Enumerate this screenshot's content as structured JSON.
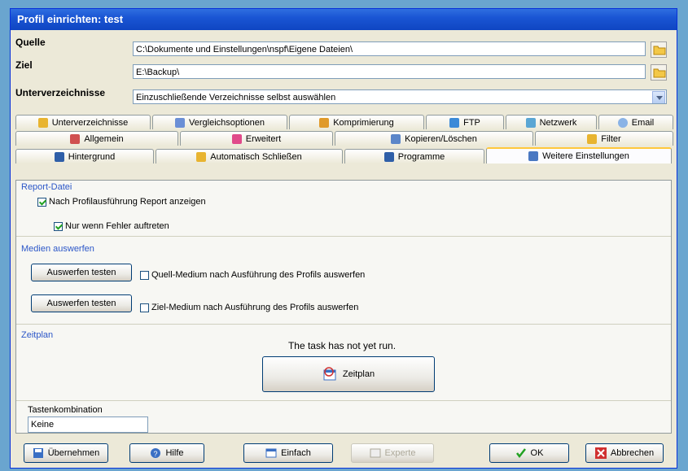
{
  "window": {
    "title": "Profil einrichten: test"
  },
  "fields": {
    "source": {
      "label": "Quelle",
      "value": "C:\\Dokumente und Einstellungen\\nspf\\Eigene Dateien\\"
    },
    "target": {
      "label": "Ziel",
      "value": "E:\\Backup\\"
    },
    "subdirs": {
      "label": "Unterverzeichnisse",
      "value": "Einzuschließende Verzeichnisse selbst auswählen"
    }
  },
  "tabs": {
    "row1": [
      "Unterverzeichnisse",
      "Vergleichsoptionen",
      "Komprimierung",
      "FTP",
      "Netzwerk",
      "Email"
    ],
    "row2": [
      "Allgemein",
      "Erweitert",
      "Kopieren/Löschen",
      "Filter"
    ],
    "row3": [
      "Hintergrund",
      "Automatisch Schließen",
      "Programme",
      "Weitere Einstellungen"
    ]
  },
  "report": {
    "group": "Report-Datei",
    "show_report": {
      "label": "Nach Profilausführung Report anzeigen",
      "checked": true
    },
    "only_errors": {
      "label": "Nur wenn Fehler auftreten",
      "checked": true
    }
  },
  "eject": {
    "group": "Medien auswerfen",
    "source_test_button": "Auswerfen testen",
    "source_label": "Quell-Medium nach Ausführung des Profils auswerfen",
    "target_test_button": "Auswerfen testen",
    "target_label": "Ziel-Medium nach Ausführung des Profils auswerfen"
  },
  "schedule": {
    "group": "Zeitplan",
    "status": "The task has not yet run.",
    "button": "Zeitplan"
  },
  "hotkey": {
    "group": "Tastenkombination",
    "value": "Keine"
  },
  "footer": {
    "apply": "Übernehmen",
    "help": "Hilfe",
    "simple": "Einfach",
    "expert": "Experte",
    "ok": "OK",
    "cancel": "Abbrechen"
  },
  "colors": {
    "title_bar": "#1a55d4",
    "accent_tab": "#ffc83c",
    "group_label": "#2c57c8"
  }
}
